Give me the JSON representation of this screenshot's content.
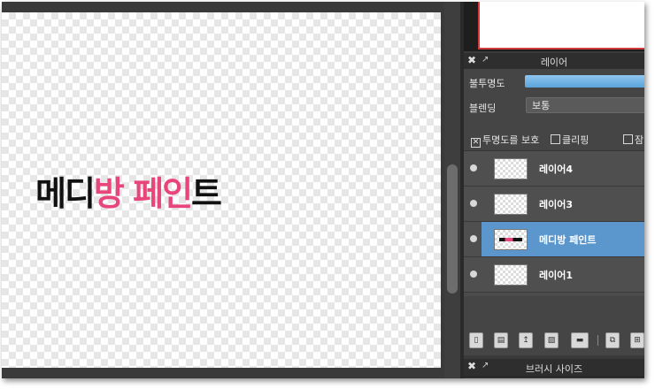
{
  "canvas": {
    "text_parts": [
      {
        "text": "메디",
        "color": "#111111"
      },
      {
        "text": "방 페인",
        "color": "#e8457a"
      },
      {
        "text": "트",
        "color": "#111111"
      }
    ]
  },
  "layer_panel": {
    "title": "레이어",
    "close_glyph": "✖",
    "popout_glyph": "↗",
    "opacity_label": "불투명도",
    "opacity_value": 1.0,
    "blend_label": "블렌딩",
    "blend_value": "보통",
    "protect_alpha": {
      "label": "투명도를 보호",
      "checked": true
    },
    "clipping": {
      "label": "클리핑",
      "checked": false
    },
    "lock": {
      "label": "잠",
      "checked": false
    },
    "layers": [
      {
        "name": "레이어4",
        "selected": false,
        "has_content": false
      },
      {
        "name": "레이어3",
        "selected": false,
        "has_content": false
      },
      {
        "name": "메디방 페인트",
        "selected": true,
        "has_content": true
      },
      {
        "name": "레이어1",
        "selected": false,
        "has_content": false
      }
    ],
    "toolbar_icons": [
      "new-layer-icon",
      "new-halftone-layer-icon",
      "new-8bit-layer-icon",
      "new-1bit-layer-icon",
      "folder-icon",
      "duplicate-icon",
      "merge-icon"
    ]
  },
  "brush_panel": {
    "title": "브러시 사이즈",
    "close_glyph": "✖",
    "popout_glyph": "↗"
  },
  "colors": {
    "selection": "#5b97cd",
    "accent_pink": "#e8457a",
    "opacity_fill": "#6fb2e6"
  }
}
